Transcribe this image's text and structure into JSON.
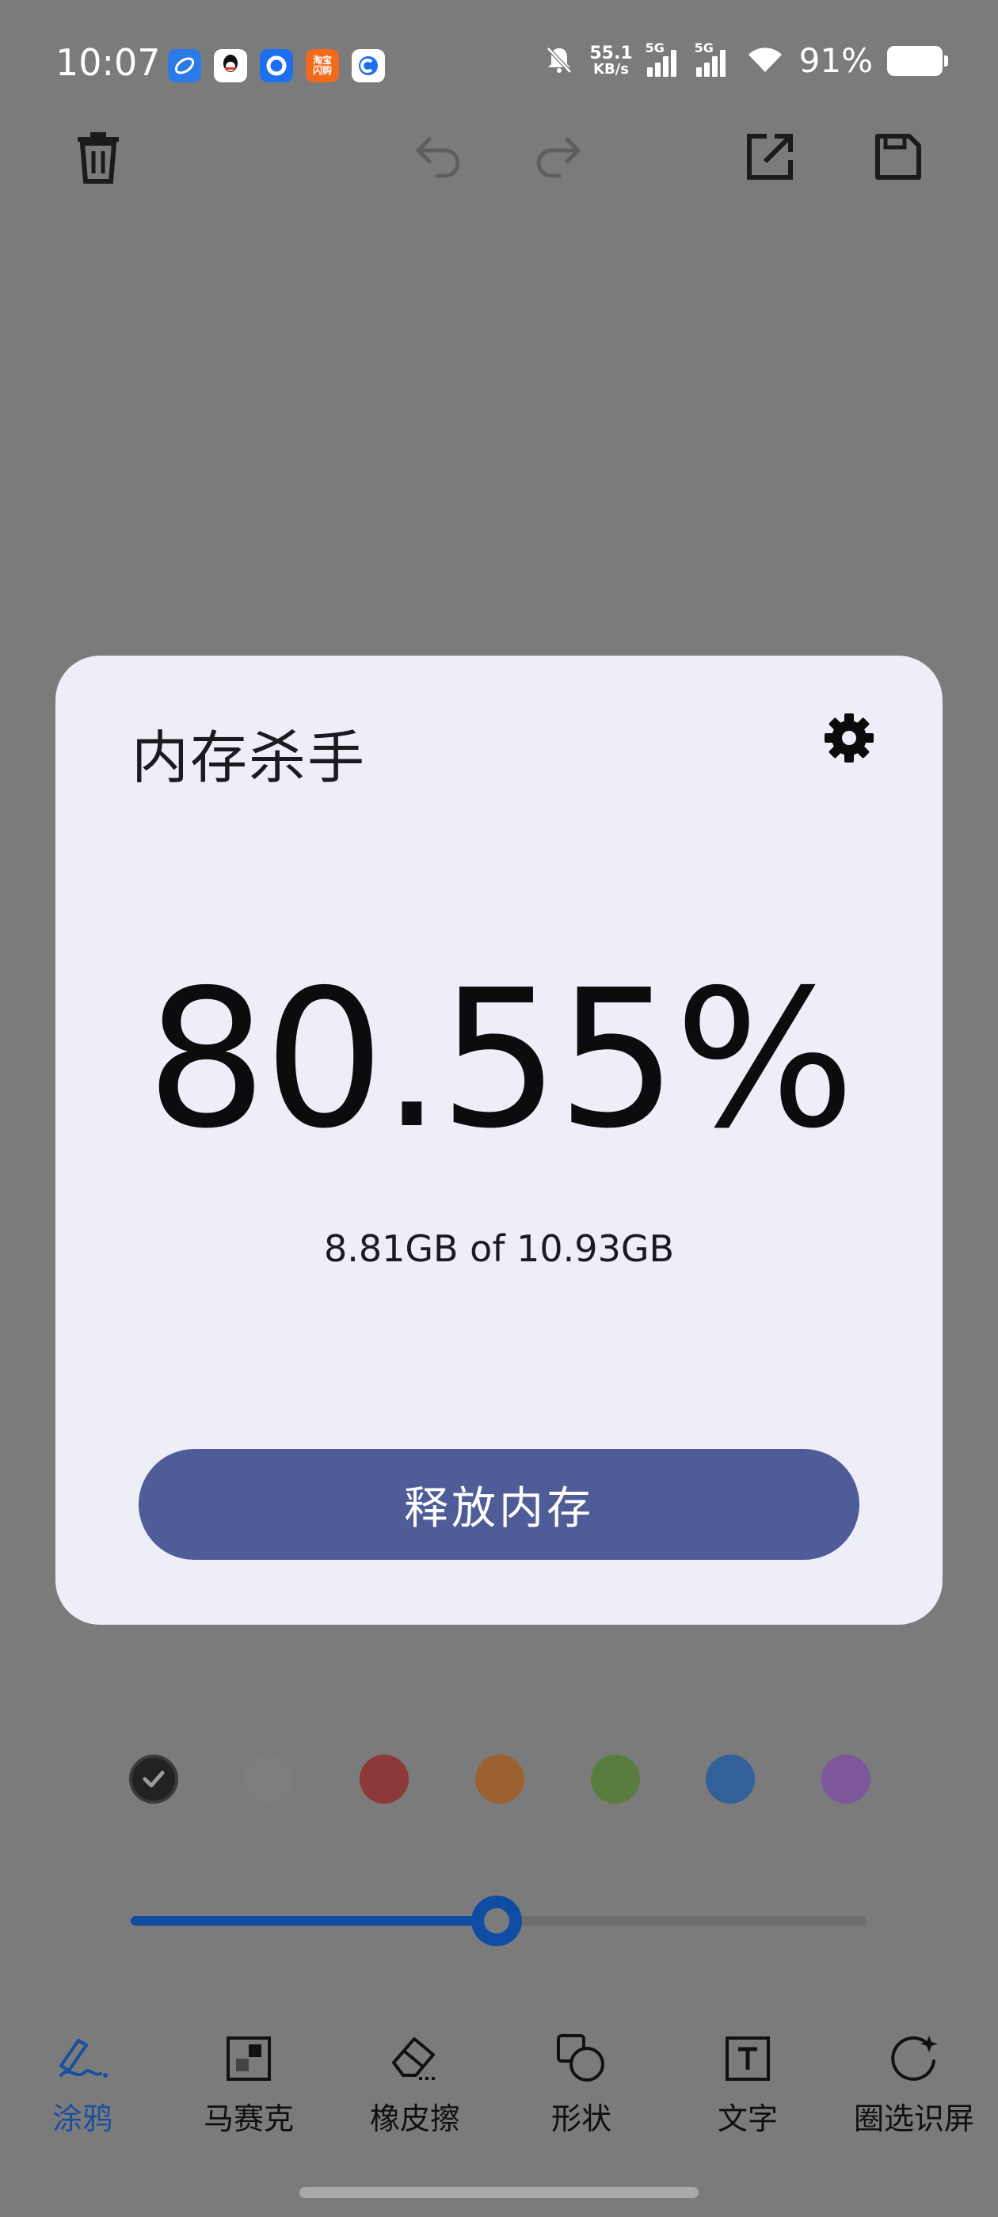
{
  "status_bar": {
    "time": "10:07",
    "net_speed_value": "55.1",
    "net_speed_unit": "KB/s",
    "signal1_tag": "5G",
    "signal2_tag": "5G",
    "battery": "91%",
    "app_icons": [
      {
        "name": "browser-app-icon",
        "color": "#2a7ae8"
      },
      {
        "name": "qq-app-icon",
        "color": "#ffffff"
      },
      {
        "name": "app-c-icon",
        "color": "#1d6ff2"
      },
      {
        "name": "taobao-flash-app-icon",
        "color": "#f26a1b",
        "text": "淘宝\n闪购"
      },
      {
        "name": "app-d-icon",
        "color": "#1d6ff2"
      }
    ]
  },
  "toolbar": {
    "delete": "trash-icon",
    "undo": "undo-icon",
    "redo": "redo-icon",
    "share": "open-external-icon",
    "save": "save-icon"
  },
  "dialog": {
    "title": "内存杀手",
    "usage_percent": "80.55%",
    "usage_detail": "8.81GB of 10.93GB",
    "release_button": "释放内存",
    "settings_icon": "gear-icon"
  },
  "palette": {
    "colors": [
      "#222222",
      "#7d7d7d",
      "#8b3939",
      "#9b6131",
      "#587d3e",
      "#335f9b",
      "#7c589a"
    ],
    "selected_index": 0
  },
  "slider": {
    "value_fraction": 0.497,
    "accent": "#0f4da4"
  },
  "tools": [
    {
      "label": "涂鸦",
      "icon": "pen-icon",
      "active": true
    },
    {
      "label": "马赛克",
      "icon": "mosaic-icon",
      "active": false
    },
    {
      "label": "橡皮擦",
      "icon": "eraser-icon",
      "active": false
    },
    {
      "label": "形状",
      "icon": "shape-icon",
      "active": false
    },
    {
      "label": "文字",
      "icon": "text-icon",
      "active": false
    },
    {
      "label": "圈选识屏",
      "icon": "circle-search-icon",
      "active": false
    }
  ]
}
